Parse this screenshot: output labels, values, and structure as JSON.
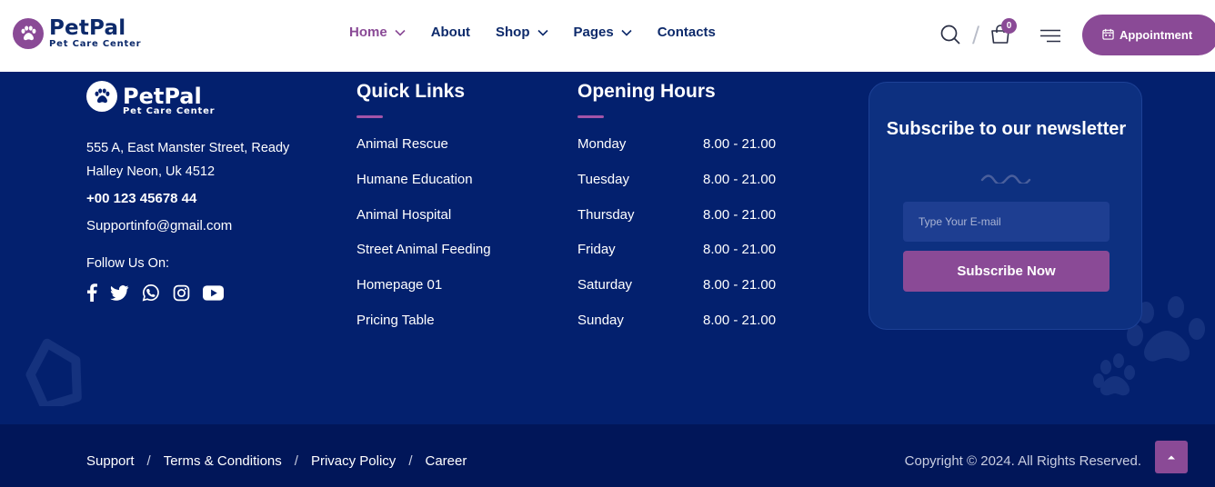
{
  "header": {
    "logo_title": "PetPal",
    "logo_sub": "Pet Care Center",
    "nav": [
      {
        "label": "Home",
        "has_dropdown": true,
        "active": true
      },
      {
        "label": "About",
        "has_dropdown": false,
        "active": false
      },
      {
        "label": "Shop",
        "has_dropdown": true,
        "active": false
      },
      {
        "label": "Pages",
        "has_dropdown": true,
        "active": false
      },
      {
        "label": "Contacts",
        "has_dropdown": false,
        "active": false
      }
    ],
    "slash": "/",
    "cart_count": "0",
    "appointment_label": "Appointment",
    "icons": [
      "search-icon",
      "cart-icon",
      "menu-icon",
      "calendar-icon"
    ]
  },
  "footer": {
    "logo_title": "PetPal",
    "logo_sub": "Pet Care Center",
    "address": "555 A, East Manster Street, Ready Halley Neon, Uk 4512",
    "phone": "+00 123 45678 44",
    "email": "Supportinfo@gmail.com",
    "follow_label": "Follow Us On:",
    "socials": [
      "facebook-icon",
      "twitter-icon",
      "whatsapp-icon",
      "instagram-icon",
      "youtube-icon"
    ],
    "quick_links_title": "Quick Links",
    "quick_links": [
      "Animal Rescue",
      "Humane Education",
      "Animal Hospital",
      "Street Animal Feeding",
      "Homepage 01",
      "Pricing Table"
    ],
    "hours_title": "Opening Hours",
    "hours": [
      {
        "day": "Monday",
        "time": "8.00 - 21.00"
      },
      {
        "day": "Tuesday",
        "time": "8.00 - 21.00"
      },
      {
        "day": "Thursday",
        "time": "8.00 - 21.00"
      },
      {
        "day": "Friday",
        "time": "8.00 - 21.00"
      },
      {
        "day": "Saturday",
        "time": "8.00 - 21.00"
      },
      {
        "day": "Sunday",
        "time": "8.00 - 21.00"
      }
    ],
    "newsletter": {
      "title": "Subscribe to our newsletter",
      "placeholder": "Type Your E-mail",
      "button": "Subscribe Now"
    }
  },
  "bottom": {
    "links": [
      "Support",
      "Terms & Conditions",
      "Privacy Policy",
      "Career"
    ],
    "separator": "/",
    "copyright": "Copyright © 2024. All Rights Reserved."
  },
  "colors": {
    "brand_purple": "#8a4a96",
    "navy": "#03206e",
    "header_text": "#0d2a6b",
    "bottom_bar": "#011659"
  }
}
